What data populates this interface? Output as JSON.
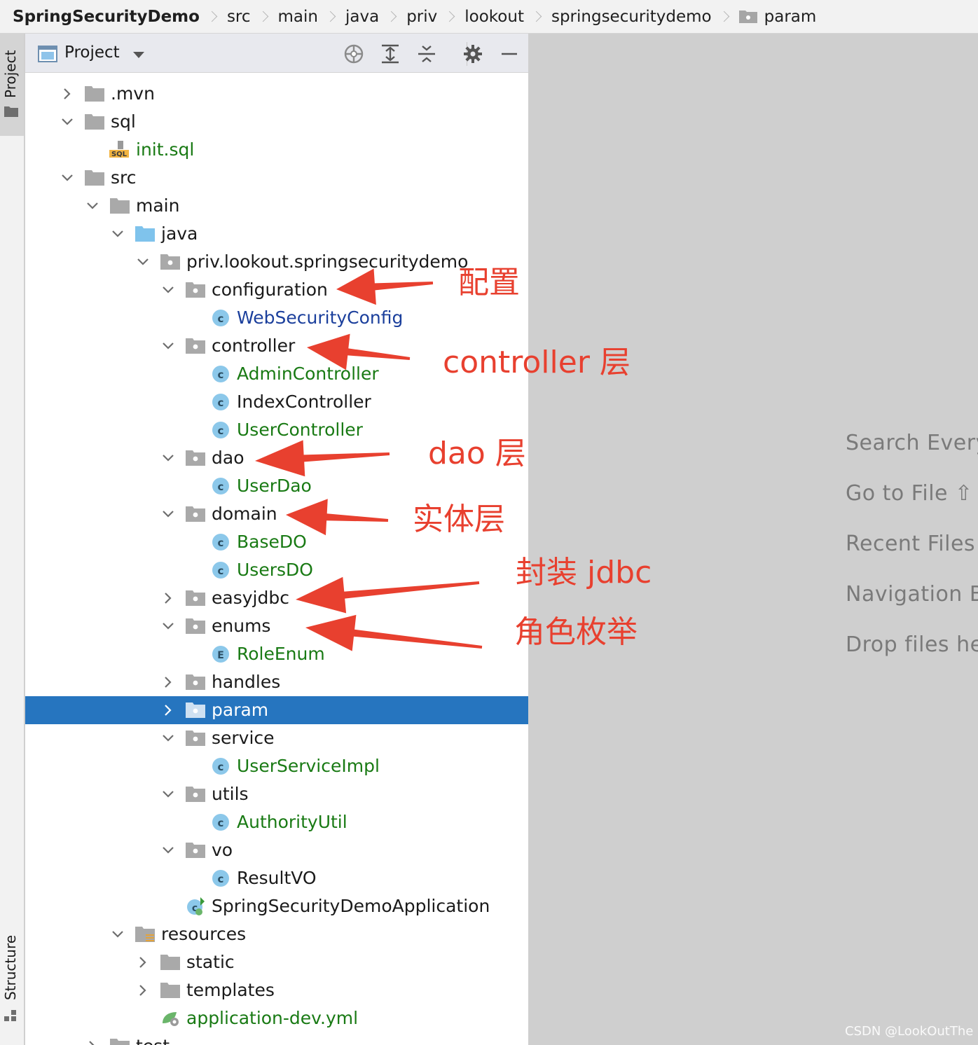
{
  "breadcrumb": [
    "SpringSecurityDemo",
    "src",
    "main",
    "java",
    "priv",
    "lookout",
    "springsecuritydemo",
    "param"
  ],
  "side_strip": {
    "project_label": "Project",
    "structure_label": "Structure"
  },
  "panel": {
    "title": "Project",
    "toolbar_icons": [
      "locate-icon",
      "expand-all-icon",
      "collapse-all-icon",
      "gear-icon",
      "minimize-icon"
    ]
  },
  "tree": [
    {
      "label": ".mvn",
      "depth": 0,
      "expand": "collapsed",
      "icon": "folder",
      "color": "black"
    },
    {
      "label": "sql",
      "depth": 0,
      "expand": "expanded",
      "icon": "folder",
      "color": "black"
    },
    {
      "label": "init.sql",
      "depth": 1,
      "expand": "none",
      "icon": "sql",
      "color": "green"
    },
    {
      "label": "src",
      "depth": 0,
      "expand": "expanded",
      "icon": "folder",
      "color": "black"
    },
    {
      "label": "main",
      "depth": 1,
      "expand": "expanded",
      "icon": "folder",
      "color": "black"
    },
    {
      "label": "java",
      "depth": 2,
      "expand": "expanded",
      "icon": "source-folder",
      "color": "black"
    },
    {
      "label": "priv.lookout.springsecuritydemo",
      "depth": 3,
      "expand": "expanded",
      "icon": "package",
      "color": "black"
    },
    {
      "label": "configuration",
      "depth": 4,
      "expand": "expanded",
      "icon": "package",
      "color": "black"
    },
    {
      "label": "WebSecurityConfig",
      "depth": 5,
      "expand": "none",
      "icon": "class",
      "color": "blue"
    },
    {
      "label": "controller",
      "depth": 4,
      "expand": "expanded",
      "icon": "package",
      "color": "black"
    },
    {
      "label": "AdminController",
      "depth": 5,
      "expand": "none",
      "icon": "class",
      "color": "green"
    },
    {
      "label": "IndexController",
      "depth": 5,
      "expand": "none",
      "icon": "class",
      "color": "black"
    },
    {
      "label": "UserController",
      "depth": 5,
      "expand": "none",
      "icon": "class",
      "color": "green"
    },
    {
      "label": "dao",
      "depth": 4,
      "expand": "expanded",
      "icon": "package",
      "color": "black"
    },
    {
      "label": "UserDao",
      "depth": 5,
      "expand": "none",
      "icon": "class",
      "color": "green"
    },
    {
      "label": "domain",
      "depth": 4,
      "expand": "expanded",
      "icon": "package",
      "color": "black"
    },
    {
      "label": "BaseDO",
      "depth": 5,
      "expand": "none",
      "icon": "class",
      "color": "green"
    },
    {
      "label": "UsersDO",
      "depth": 5,
      "expand": "none",
      "icon": "class",
      "color": "green"
    },
    {
      "label": "easyjdbc",
      "depth": 4,
      "expand": "collapsed",
      "icon": "package",
      "color": "black"
    },
    {
      "label": "enums",
      "depth": 4,
      "expand": "expanded",
      "icon": "package",
      "color": "black"
    },
    {
      "label": "RoleEnum",
      "depth": 5,
      "expand": "none",
      "icon": "enum",
      "color": "green"
    },
    {
      "label": "handles",
      "depth": 4,
      "expand": "collapsed",
      "icon": "package",
      "color": "black"
    },
    {
      "label": "param",
      "depth": 4,
      "expand": "collapsed",
      "icon": "package",
      "color": "white",
      "selected": true
    },
    {
      "label": "service",
      "depth": 4,
      "expand": "expanded",
      "icon": "package",
      "color": "black"
    },
    {
      "label": "UserServiceImpl",
      "depth": 5,
      "expand": "none",
      "icon": "class",
      "color": "green"
    },
    {
      "label": "utils",
      "depth": 4,
      "expand": "expanded",
      "icon": "package",
      "color": "black"
    },
    {
      "label": "AuthorityUtil",
      "depth": 5,
      "expand": "none",
      "icon": "class",
      "color": "green"
    },
    {
      "label": "vo",
      "depth": 4,
      "expand": "expanded",
      "icon": "package",
      "color": "black"
    },
    {
      "label": "ResultVO",
      "depth": 5,
      "expand": "none",
      "icon": "class",
      "color": "black"
    },
    {
      "label": "SpringSecurityDemoApplication",
      "depth": 4,
      "expand": "none",
      "icon": "spring-boot-class",
      "color": "black"
    },
    {
      "label": "resources",
      "depth": 2,
      "expand": "expanded",
      "icon": "resources-folder",
      "color": "black"
    },
    {
      "label": "static",
      "depth": 3,
      "expand": "collapsed",
      "icon": "folder",
      "color": "black"
    },
    {
      "label": "templates",
      "depth": 3,
      "expand": "collapsed",
      "icon": "folder",
      "color": "black"
    },
    {
      "label": "application-dev.yml",
      "depth": 3,
      "expand": "none",
      "icon": "yml",
      "color": "green"
    },
    {
      "label": "test",
      "depth": 1,
      "expand": "collapsed",
      "icon": "folder",
      "color": "black"
    }
  ],
  "editor_hints": [
    "Search Every",
    "Go to File ⇧",
    "Recent Files",
    "Navigation B",
    "Drop files he"
  ],
  "annotations": [
    {
      "text": "配置",
      "target": "configuration"
    },
    {
      "text": "controller 层",
      "target": "controller"
    },
    {
      "text": "dao 层",
      "target": "dao"
    },
    {
      "text": "实体层",
      "target": "domain"
    },
    {
      "text": "封装 jdbc",
      "target": "easyjdbc"
    },
    {
      "text": "角色枚举",
      "target": "enums"
    }
  ],
  "watermark": "CSDN @LookOutThe",
  "colors": {
    "selection": "#2675bf",
    "annotation": "#e8402f",
    "green_label": "#197a14",
    "blue_label": "#1b3f9c"
  }
}
